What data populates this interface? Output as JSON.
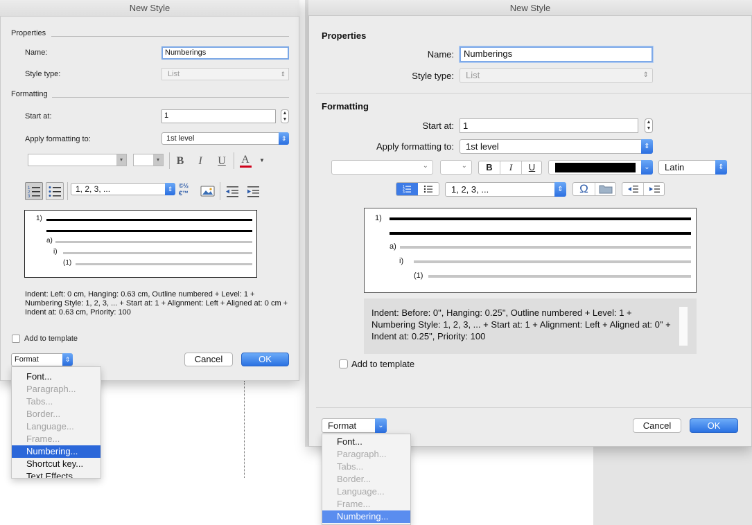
{
  "left": {
    "window_title": "New Style",
    "properties_label": "Properties",
    "name_label": "Name:",
    "name_value": "Numberings",
    "style_type_label": "Style type:",
    "style_type_value": "List",
    "formatting_label": "Formatting",
    "start_at_label": "Start at:",
    "start_at_value": "1",
    "apply_label": "Apply formatting to:",
    "apply_value": "1st level",
    "bold": "B",
    "italic": "I",
    "underline": "U",
    "font_color_glyph": "A",
    "font_color": "#d0021b",
    "numbering_format": "1, 2, 3, ...",
    "special_char_glyph": "©½€™",
    "preview_numbers": [
      "1)",
      "a)",
      "i)",
      "(1)"
    ],
    "description": "Indent: Left:  0 cm, Hanging:  0.63 cm, Outline numbered + Level: 1 + Numbering Style: 1, 2, 3, ... + Start at: 1 + Alignment: Left + Aligned at: 0 cm + Indent at:  0.63 cm, Priority: 100",
    "add_to_template": "Add to template",
    "format_button": "Format",
    "cancel": "Cancel",
    "ok": "OK",
    "menu": [
      "Font...",
      "Paragraph...",
      "Tabs...",
      "Border...",
      "Language...",
      "Frame...",
      "Numbering...",
      "Shortcut key...",
      "Text Effects..."
    ],
    "menu_selected": "Numbering..."
  },
  "right": {
    "window_title": "New Style",
    "properties_label": "Properties",
    "name_label": "Name:",
    "name_value": "Numberings",
    "style_type_label": "Style type:",
    "style_type_value": "List",
    "formatting_label": "Formatting",
    "start_at_label": "Start at:",
    "start_at_value": "1",
    "apply_label": "Apply formatting to:",
    "apply_value": "1st level",
    "bold": "B",
    "italic": "I",
    "underline": "U",
    "font_color": "#000000",
    "script_value": "Latin",
    "numbering_format": "1, 2, 3, ...",
    "omega_glyph": "Ω",
    "preview_numbers": [
      "1)",
      "a)",
      "i)",
      "(1)"
    ],
    "description": "Indent: Before:  0\", Hanging:  0.25\", Outline numbered + Level: 1 + Numbering Style: 1, 2, 3, ... + Start at: 1 + Alignment: Left + Aligned at: 0\" + Indent at:  0.25\", Priority: 100",
    "add_to_template": "Add to template",
    "format_button": "Format",
    "cancel": "Cancel",
    "ok": "OK",
    "menu": [
      "Font...",
      "Paragraph...",
      "Tabs...",
      "Border...",
      "Language...",
      "Frame...",
      "Numbering..."
    ],
    "menu_selected": "Numbering..."
  },
  "colors": {
    "accent": "#2b6fe0",
    "dialog_bg": "#ececec",
    "menu_highlight_left": "#2b67d9",
    "menu_highlight_right": "#5a8def"
  }
}
